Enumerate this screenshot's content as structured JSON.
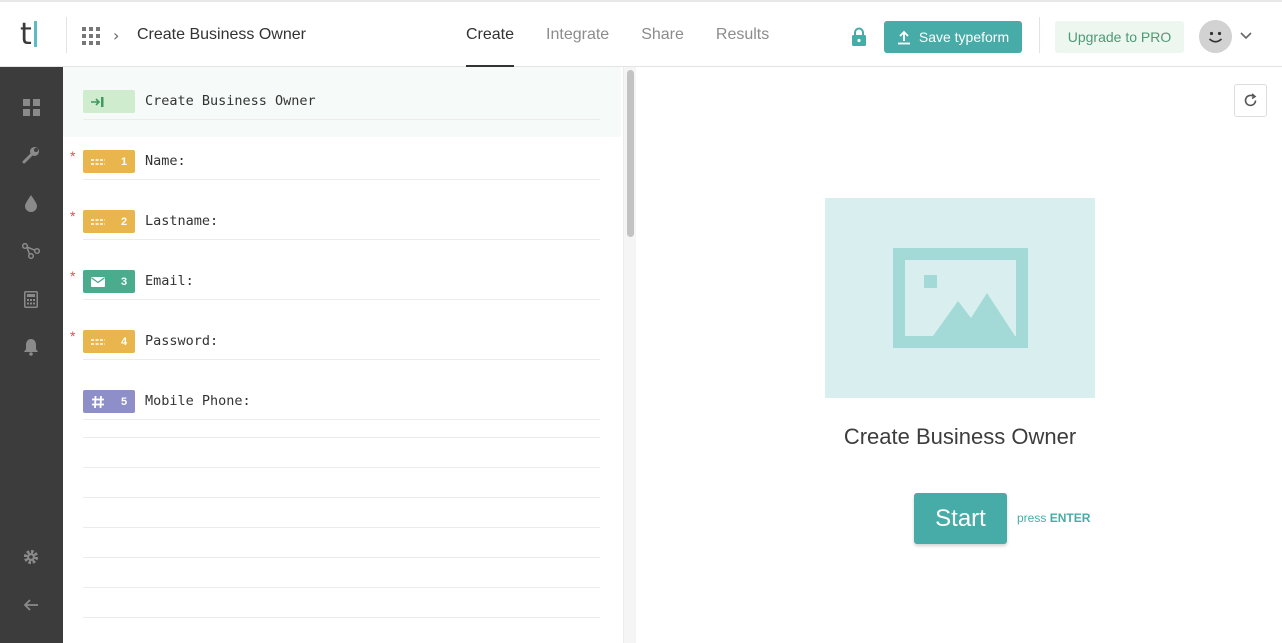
{
  "header": {
    "logo_letter": "t",
    "breadcrumb_title": "Create Business Owner",
    "tabs": [
      {
        "label": "Create"
      },
      {
        "label": "Integrate"
      },
      {
        "label": "Share"
      },
      {
        "label": "Results"
      }
    ],
    "save_label": "Save typeform",
    "upgrade_label": "Upgrade to PRO"
  },
  "sidebar": {
    "items": [
      {
        "icon": "dashboard-grid-icon"
      },
      {
        "icon": "wrench-icon"
      },
      {
        "icon": "drop-icon"
      },
      {
        "icon": "logic-jump-icon"
      },
      {
        "icon": "calculator-icon"
      },
      {
        "icon": "bell-icon"
      },
      {
        "icon": "gear-icon"
      },
      {
        "icon": "back-arrow-icon"
      }
    ]
  },
  "editor": {
    "welcome": {
      "text": "Create Business Owner"
    },
    "questions": [
      {
        "number": "1",
        "text": "Name:",
        "type": "short-text",
        "required": true
      },
      {
        "number": "2",
        "text": "Lastname:",
        "type": "short-text",
        "required": true
      },
      {
        "number": "3",
        "text": "Email:",
        "type": "email",
        "required": true
      },
      {
        "number": "4",
        "text": "Password:",
        "type": "short-text",
        "required": true
      },
      {
        "number": "5",
        "text": "Mobile Phone:",
        "type": "number",
        "required": false
      }
    ],
    "required_mark": "*"
  },
  "preview": {
    "title": "Create Business Owner",
    "start_label": "Start",
    "press_prefix": "press",
    "press_key": "ENTER"
  },
  "colors": {
    "accent": "#47aca8",
    "short_text_badge": "#e9b64d",
    "email_badge": "#4aab8d",
    "number_badge": "#8e8fc8",
    "welcome_badge": "#cfeccf",
    "sidebar_bg": "#3c3c3c",
    "image_placeholder": "#d9efef"
  }
}
